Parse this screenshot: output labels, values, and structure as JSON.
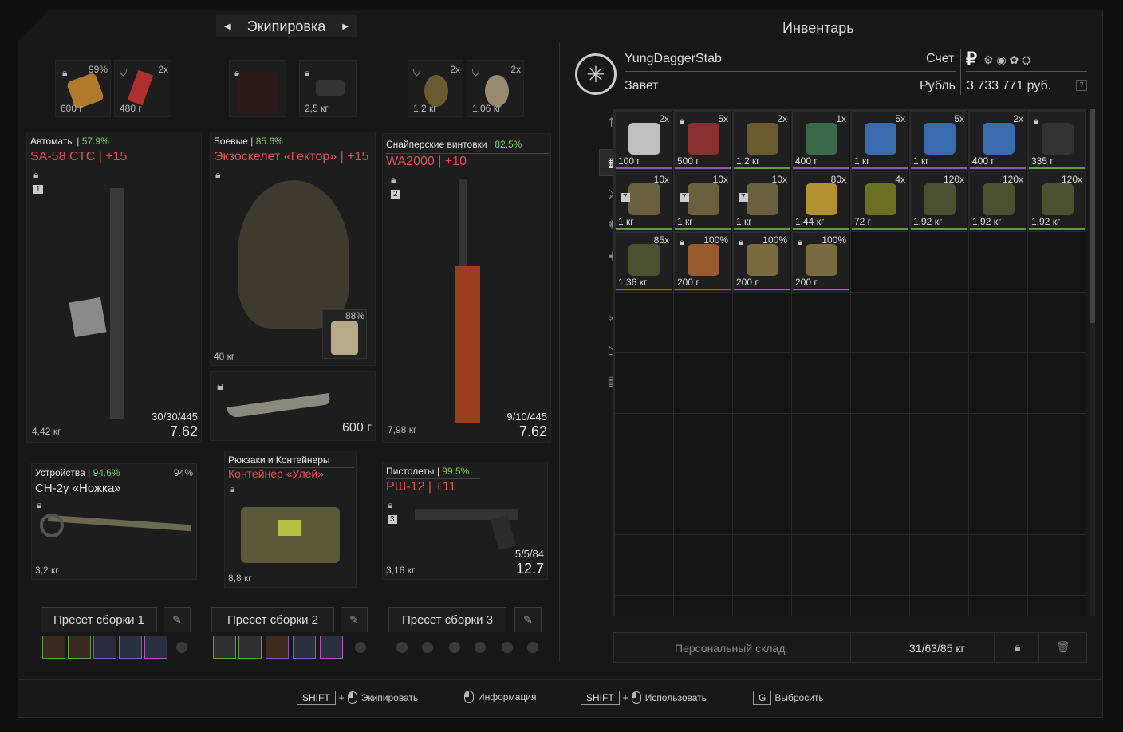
{
  "equipment": {
    "title": "Экипировка"
  },
  "inventory": {
    "title": "Инвентарь"
  },
  "top_slots": [
    {
      "pct": "99%",
      "weight": "600 г"
    },
    {
      "qty": "2x",
      "weight": "480 г"
    },
    {
      "weight": ""
    },
    {
      "weight": "2,5 кг"
    },
    {
      "qty": "2x",
      "weight": "1,2 кг"
    },
    {
      "qty": "2x",
      "weight": "1,06 кг"
    }
  ],
  "weapons": {
    "rifles": {
      "category": "Автоматы",
      "pct": "57.9%",
      "name": "SA-58 СТС",
      "bonus": "+15",
      "slot": "1",
      "weight": "4,42 кг",
      "ammo": "30/30/445",
      "caliber": "7.62"
    },
    "armor": {
      "category": "Боевые",
      "pct": "85.6%",
      "name": "Экзоскелет «Гектор»",
      "bonus": "+15",
      "weight": "40 кг",
      "plate_pct": "88%"
    },
    "knife": {
      "weight": "600 г"
    },
    "sniper": {
      "category": "Снайперские винтовки",
      "pct": "82.5%",
      "name": "WA2000",
      "bonus": "+10",
      "slot": "2",
      "weight": "7,98 кг",
      "ammo": "9/10/445",
      "caliber": "7.62"
    },
    "devices": {
      "category": "Устройства",
      "pct": "94.6%",
      "name": "СН-2у «Ножка»",
      "durability": "94%",
      "weight": "3,2 кг"
    },
    "backpack": {
      "category": "Рюкзаки и Контейнеры",
      "name": "Контейнер «Улей»",
      "weight": "8,8 кг"
    },
    "pistol": {
      "category": "Пистолеты",
      "pct": "99.5%",
      "name": "РШ-12",
      "bonus": "+11",
      "slot": "3",
      "weight": "3,16 кг",
      "ammo": "5/5/84",
      "caliber": "12.7"
    }
  },
  "presets": [
    "Пресет сборки 1",
    "Пресет сборки 2",
    "Пресет сборки 3"
  ],
  "player": {
    "name": "YungDaggerStab",
    "faction": "Завет",
    "account_label": "Счет",
    "currency_label": "Рубль",
    "balance": "3 733 771 руб.",
    "currency_symbol": "₽"
  },
  "inventory_items": [
    {
      "q": "2x",
      "w": "100 г",
      "bar": "#8a5ab0"
    },
    {
      "q": "5x",
      "w": "500 г",
      "bar": "#8a5ab0",
      "lock": true
    },
    {
      "q": "2x",
      "w": "1,2 кг",
      "bar": "#5aa040"
    },
    {
      "q": "1x",
      "w": "400 г",
      "bar": "#8a5ab0"
    },
    {
      "q": "5x",
      "w": "1 кг",
      "bar": "#8a5ab0"
    },
    {
      "q": "5x",
      "w": "1 кг",
      "bar": "#8a5ab0"
    },
    {
      "q": "2x",
      "w": "400 г",
      "bar": "#8a5ab0"
    },
    {
      "q": "",
      "w": "335 г",
      "bar": "#5aa040",
      "lock": true
    },
    {
      "q": "10x",
      "w": "1 кг",
      "bar": "#5aa040",
      "badge": "7"
    },
    {
      "q": "10x",
      "w": "1 кг",
      "bar": "#5aa040",
      "badge": "7"
    },
    {
      "q": "10x",
      "w": "1 кг",
      "bar": "#5aa040",
      "badge": "7"
    },
    {
      "q": "80x",
      "w": "1,44 кг",
      "bar": "#5aa040"
    },
    {
      "q": "4x",
      "w": "72 г",
      "bar": "#5aa040"
    },
    {
      "q": "120x",
      "w": "1,92 кг",
      "bar": "#5aa040"
    },
    {
      "q": "120x",
      "w": "1,92 кг",
      "bar": "#5aa040"
    },
    {
      "q": "120x",
      "w": "1,92 кг",
      "bar": "#5aa040"
    },
    {
      "q": "85x",
      "w": "1,36 кг",
      "bar": "#8a5ab0"
    },
    {
      "q": "100%",
      "w": "200 г",
      "bar": "#8a5ab0",
      "lock": true
    },
    {
      "q": "100%",
      "w": "200 г",
      "bar": "#5aa040",
      "lock": true
    },
    {
      "q": "100%",
      "w": "200 г",
      "bar": "#5aa040",
      "lock": true
    }
  ],
  "stash": {
    "label": "Персональный склад",
    "weight": "31/63/85 кг"
  },
  "hints": {
    "shift": "SHIFT",
    "equip": "Экипировать",
    "info": "Информация",
    "use": "Использовать",
    "g": "G",
    "drop": "Выбросить"
  },
  "help": "?"
}
